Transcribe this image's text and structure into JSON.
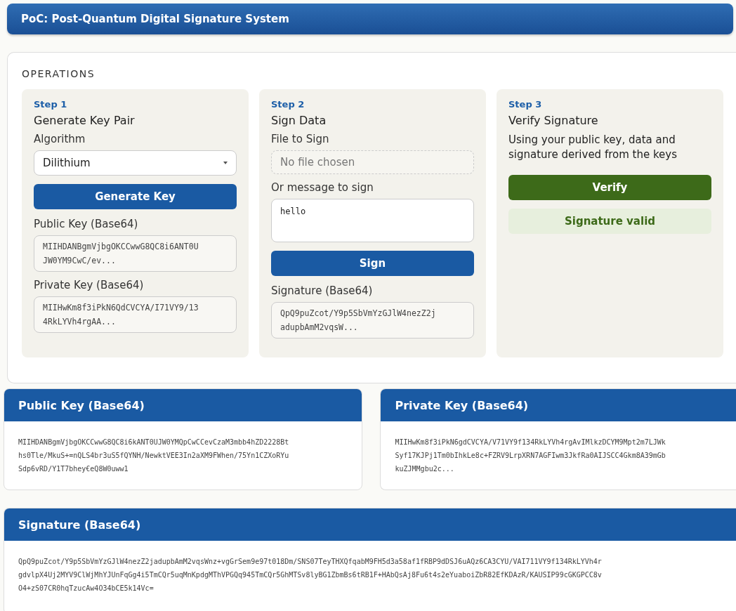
{
  "header": {
    "title": "PoC: Post-Quantum Digital Signature System"
  },
  "operations": {
    "title": "OPERATIONS",
    "step1": {
      "step": "Step 1",
      "title": "Generate Key Pair",
      "algorithm_label": "Algorithm",
      "algorithm": "Dilithium",
      "button": "Generate Key",
      "public_label": "Public Key (Base64)",
      "public_value": [
        "MIIHDANBgmVjbgOKCCwwG8QC8i6ANT0U",
        "JW0YM9CwC/ev..."
      ],
      "private_label": "Private Key (Base64)",
      "private_value": [
        "MIIHwKm8f3iPkN6QdCVCYA/I71VY9/13",
        "4RkLYVh4rgAA..."
      ]
    },
    "step2": {
      "step": "Step 2",
      "title": "Sign Data",
      "file_label": "File to Sign",
      "file_placeholder": "No file chosen",
      "message_label": "Or message to sign",
      "message": "hello",
      "button": "Sign",
      "signature_label": "Signature (Base64)",
      "signature_value": [
        "QpQ9puZcot/Y9p5SbVmYzGJlW4nezZ2j",
        "adupbAmM2vqsW..."
      ]
    },
    "step3": {
      "step": "Step 3",
      "title": "Verify Signature",
      "description": "Using your public key, data and signature derived from the keys",
      "button": "Verify",
      "result": "Signature valid"
    }
  },
  "public_panel": {
    "title": "Public Key (Base64)",
    "lines": [
      "MIIHDANBgmVjbgOKCCwwG8QC8i6kANT0UJW0YMQpCwCCevCzaM3mbb4hZD2228Bt",
      "hs0Tle/MkuS+=nQLS4br3uS5fQYNH/NewktVEE3In2aXM9FWhen/75Yn1CZXoRYu",
      "Sdp6vRD/Y1T7bhey€eQ8W0uww1"
    ]
  },
  "private_panel": {
    "title": "Private Key (Base64)",
    "lines": [
      "MIIHwKm8f3iPkN6gdCVCYA/V71VY9f134RkLYVh4rgAvIMlkzDCYM9Mpt2m7LJWk",
      "Syf17KJPj1Tm0bIhkLe8c+FZRV9LrpXRN7AGFIwm3JkfRa0AIJSCC4Gkm8A39mGb",
      "kuZJMMgbu2c..."
    ]
  },
  "signature_panel": {
    "title": "Signature (Base64)",
    "lines": [
      "QpQ9puZcot/Y9p5SbVmYzGJlW4nezZ2jadupbAmM2vqsWnz+vgGrSem9e97t018Dm/SNS07TeyTHXQfqabM9FH5d3a58af1fRBP9dDSJ6uAQz6CA3CYU/VAI711VY9f134RkLYVh4r",
      "gdvlpX4Uj2MYV9ClWjMhYJUnFqGg4i5TmCQr5uqMnKpdgMThVPGQq945TmCQr5GhMTSv8lyBG1ZbmBs6tRB1F+HAbQsAj8Fu6t4s2eYuaboiZbR82EfKDAzR/KAUSIP99cGKGPCC8v",
      "O4+zS07CR0hqTzucAw4O34bCE5k14Vc="
    ]
  }
}
